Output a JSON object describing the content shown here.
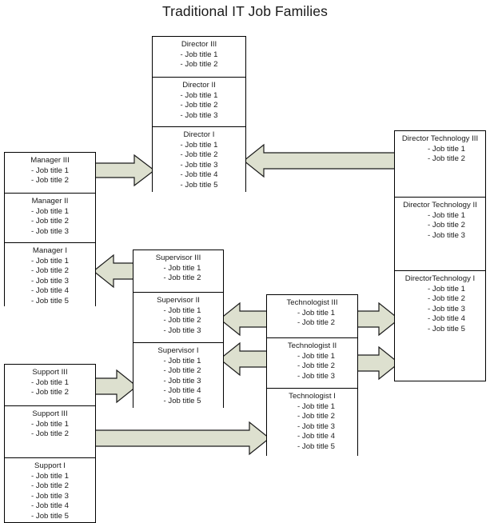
{
  "title": "Traditional IT Job Families",
  "theme": {
    "arrow_fill": "#dde0cf",
    "arrow_stroke": "#1a1a1a",
    "box_border": "#000000",
    "box_fill": "#ffffff",
    "text_color": "#1a1a1a",
    "page_background": "#ffffff"
  },
  "columns": {
    "manager": {
      "name": "Manager",
      "boxes": [
        {
          "title": "Manager III",
          "items": [
            "- Job title 1",
            "- Job title 2"
          ]
        },
        {
          "title": "Manager II",
          "items": [
            "- Job title 1",
            "- Job title 2",
            "- Job title 3"
          ]
        },
        {
          "title": "Manager I",
          "items": [
            "- Job title 1",
            "- Job title 2",
            "- Job title 3",
            "- Job title 4",
            "- Job title 5"
          ]
        }
      ]
    },
    "director": {
      "name": "Director",
      "boxes": [
        {
          "title": "Director III",
          "items": [
            "- Job title 1",
            "- Job title 2"
          ]
        },
        {
          "title": "Director II",
          "items": [
            "- Job title 1",
            "- Job title 2",
            "- Job title 3"
          ]
        },
        {
          "title": "Director I",
          "items": [
            "- Job title 1",
            "- Job title 2",
            "- Job title 3",
            "- Job title 4",
            "- Job title 5"
          ]
        }
      ]
    },
    "director_technology": {
      "name": "Director Technology",
      "boxes": [
        {
          "title": "Director Technology III",
          "items": [
            "- Job title 1",
            "- Job title 2"
          ]
        },
        {
          "title": "Director Technology  II",
          "items": [
            "- Job title 1",
            "- Job title 2",
            "- Job title 3"
          ]
        },
        {
          "title": "DirectorTechnology   I",
          "items": [
            "- Job title 1",
            "- Job title 2",
            "- Job title 3",
            "- Job title 4",
            "- Job title 5"
          ]
        }
      ]
    },
    "supervisor": {
      "name": "Supervisor",
      "boxes": [
        {
          "title": "Supervisor III",
          "items": [
            "- Job title 1",
            "- Job title 2"
          ]
        },
        {
          "title": "Supervisor II",
          "items": [
            "- Job title 1",
            "- Job title 2",
            "- Job title 3"
          ]
        },
        {
          "title": "Supervisor I",
          "items": [
            "- Job title 1",
            "- Job title 2",
            "- Job title 3",
            "- Job title 4",
            "- Job title 5"
          ]
        }
      ]
    },
    "technologist": {
      "name": "Technologist",
      "boxes": [
        {
          "title": "Technologist III",
          "items": [
            "- Job title 1",
            "- Job title 2"
          ]
        },
        {
          "title": "Technologist  II",
          "items": [
            "- Job title 1",
            "- Job title 2",
            "- Job title 3"
          ]
        },
        {
          "title": "Technologist   I",
          "items": [
            "- Job title 1",
            "- Job title 2",
            "- Job title 3",
            "- Job title 4",
            "- Job title 5"
          ]
        }
      ]
    },
    "support": {
      "name": "Support",
      "boxes": [
        {
          "title": "Support III",
          "items": [
            "- Job title 1",
            "- Job title 2"
          ]
        },
        {
          "title": "Support III",
          "items": [
            "- Job title 1",
            "- Job title 2"
          ]
        },
        {
          "title": "Support I",
          "items": [
            "- Job title 1",
            "- Job title 2",
            "- Job title 3",
            "- Job title 4",
            "- Job title 5"
          ]
        }
      ]
    }
  },
  "connectors": [
    {
      "id": "manager3-to-director1",
      "from": "Manager III",
      "to": "Director I",
      "direction": "right"
    },
    {
      "id": "dirtech3-to-director1",
      "from": "Director Technology III",
      "to": "Director I",
      "direction": "left"
    },
    {
      "id": "supervisor3-to-manager1",
      "from": "Supervisor III",
      "to": "Manager I",
      "direction": "left"
    },
    {
      "id": "technologist3-to-supervisor2",
      "from": "Technologist III",
      "to": "Supervisor II",
      "direction": "left"
    },
    {
      "id": "technologist2-to-supervisor1",
      "from": "Technologist  II",
      "to": "Supervisor I",
      "direction": "left"
    },
    {
      "id": "technologist3-to-dirtech1",
      "from": "Technologist III",
      "to": "DirectorTechnology   I",
      "direction": "right"
    },
    {
      "id": "technologist2-to-dirtech1",
      "from": "Technologist  II",
      "to": "DirectorTechnology   I",
      "direction": "right"
    },
    {
      "id": "support3-to-supervisor1",
      "from": "Support III",
      "to": "Supervisor I",
      "direction": "right"
    },
    {
      "id": "support3b-to-technologist1",
      "from": "Support III",
      "to": "Technologist   I",
      "direction": "right"
    }
  ]
}
